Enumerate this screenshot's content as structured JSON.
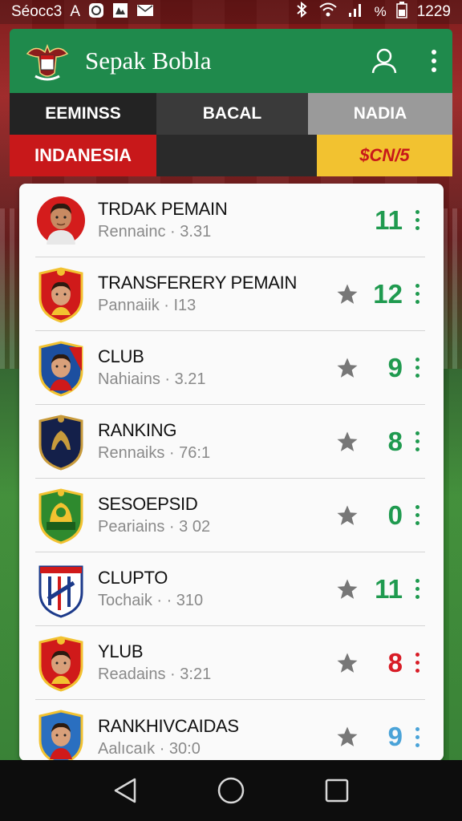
{
  "status_bar": {
    "carrier": "Séocc3",
    "letter": "A",
    "time": "1229",
    "icons": [
      "at-icon",
      "image-icon",
      "mail-icon",
      "bluetooth-icon",
      "wifi-icon",
      "signal-icon",
      "battery-icon"
    ]
  },
  "header": {
    "title": "Sepak Bobla",
    "logo_icon": "garuda-crest-icon",
    "profile_icon": "user-icon",
    "menu_icon": "more-vertical-icon"
  },
  "tabs_row1": [
    "EEMINSS",
    "BACAL",
    "NADIA"
  ],
  "tabs_row2": [
    "INDANESIA",
    "",
    "$CN/5"
  ],
  "list": [
    {
      "title": "TRDAK PEMAIN",
      "subtitle": "Rennainc · 3.31",
      "score": "11",
      "score_color": "#1f9a4f",
      "star": false,
      "dots_color": "#1f9a4f",
      "avatar": "player-avatar-red"
    },
    {
      "title": "TRANSFERERY PEMAIN",
      "subtitle": "Pannaiik · I13",
      "score": "12",
      "score_color": "#1f9a4f",
      "star": true,
      "dots_color": "#1f9a4f",
      "avatar": "player-crest-red"
    },
    {
      "title": "CLUB",
      "subtitle": "Nahiains · 3.21",
      "score": "9",
      "score_color": "#1f9a4f",
      "star": true,
      "dots_color": "#1f9a4f",
      "avatar": "player-crest-blue"
    },
    {
      "title": "RANKING",
      "subtitle": "Rennaiks · 76:1",
      "score": "8",
      "score_color": "#1f9a4f",
      "star": true,
      "dots_color": "#1f9a4f",
      "avatar": "club-crest-navy"
    },
    {
      "title": "SESOEPSID",
      "subtitle": "Peariains · 3 02",
      "score": "0",
      "score_color": "#1f9a4f",
      "star": true,
      "dots_color": "#1f9a4f",
      "avatar": "club-crest-green"
    },
    {
      "title": "CLUPTO",
      "subtitle": "Tochaik · · 310",
      "score": "11",
      "score_color": "#1f9a4f",
      "star": true,
      "dots_color": "#1f9a4f",
      "avatar": "club-crest-stripes"
    },
    {
      "title": "YLUB",
      "subtitle": "Readains · 3:21",
      "score": "8",
      "score_color": "#d81c26",
      "star": true,
      "dots_color": "#d81c26",
      "avatar": "player-crest-red"
    },
    {
      "title": "RANKHIVCAIDAS",
      "subtitle": "Aalıcaık · 30:0",
      "score": "9",
      "score_color": "#4aa3d8",
      "star": true,
      "dots_color": "#4aa3d8",
      "avatar": "player-crest-blue"
    }
  ],
  "nav_bar": {
    "back_icon": "back-triangle-icon",
    "home_icon": "home-circle-icon",
    "recents_icon": "recents-square-icon"
  },
  "colors": {
    "header_green": "#1f8a4c",
    "accent_red": "#c8181a",
    "accent_yellow": "#f2c230"
  }
}
